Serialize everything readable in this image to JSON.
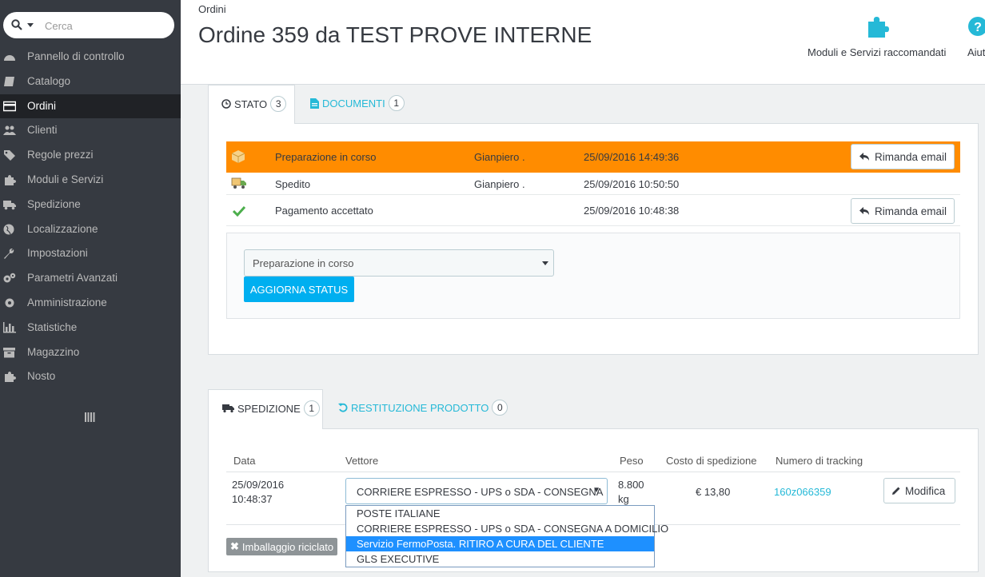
{
  "search": {
    "placeholder": "Cerca"
  },
  "sidebar": {
    "items": [
      {
        "label": "Pannello di controllo",
        "icon": "dashboard-icon"
      },
      {
        "label": "Catalogo",
        "icon": "book-icon"
      },
      {
        "label": "Ordini",
        "icon": "credit-card-icon",
        "active": true
      },
      {
        "label": "Clienti",
        "icon": "users-icon"
      },
      {
        "label": "Regole prezzi",
        "icon": "tags-icon"
      },
      {
        "label": "Moduli e Servizi",
        "icon": "puzzle-icon"
      },
      {
        "label": "Spedizione",
        "icon": "truck-icon"
      },
      {
        "label": "Localizzazione",
        "icon": "globe-icon"
      },
      {
        "label": "Impostazioni",
        "icon": "wrench-icon"
      },
      {
        "label": "Parametri Avanzati",
        "icon": "cogs-icon"
      },
      {
        "label": "Amministrazione",
        "icon": "cog-icon"
      },
      {
        "label": "Statistiche",
        "icon": "bar-chart-icon"
      },
      {
        "label": "Magazzino",
        "icon": "archive-icon"
      },
      {
        "label": "Nosto",
        "icon": "puzzle-icon"
      }
    ]
  },
  "header": {
    "breadcrumb": "Ordini",
    "title": "Ordine 359 da TEST PROVE INTERNE",
    "toolbar": {
      "modules_label": "Moduli e Servizi raccomandati",
      "help_label": "Aiut"
    }
  },
  "status_panel": {
    "tabs": [
      {
        "label": "STATO",
        "count": "3"
      },
      {
        "label": "DOCUMENTI",
        "count": "1"
      }
    ],
    "history": [
      {
        "state": "Preparazione in corso",
        "employee": "Gianpiero .",
        "date": "25/09/2016 14:49:36",
        "resend": "Rimanda email"
      },
      {
        "state": "Spedito",
        "employee": "Gianpiero .",
        "date": "25/09/2016 10:50:50",
        "resend": ""
      },
      {
        "state": "Pagamento accettato",
        "employee": "",
        "date": "25/09/2016 10:48:38",
        "resend": "Rimanda email"
      }
    ],
    "select_value": "Preparazione in corso",
    "update_button": "AGGIORNA STATUS"
  },
  "shipping_panel": {
    "tabs": [
      {
        "label": "SPEDIZIONE",
        "count": "1"
      },
      {
        "label": "RESTITUZIONE PRODOTTO",
        "count": "0"
      }
    ],
    "columns": [
      "Data",
      "Vettore",
      "Peso",
      "Costo di spedizione",
      "Numero di tracking"
    ],
    "row": {
      "date_line1": "25/09/2016",
      "date_line2": "10:48:37",
      "carrier_selected": "CORRIERE ESPRESSO - UPS o SDA - CONSEGNA",
      "weight_line1": "8.800",
      "weight_line2": "kg",
      "cost": "€ 13,80",
      "tracking": "160z066359",
      "modify": "Modifica"
    },
    "carrier_options": [
      "POSTE ITALIANE",
      "CORRIERE ESPRESSO - UPS o SDA - CONSEGNA A DOMICILIO",
      "Servizio FermoPosta. RITIRO A CURA DEL CLIENTE",
      "GLS EXECUTIVE"
    ],
    "highlighted_option_index": 2,
    "recycled_label": "Imballaggio riciclato"
  },
  "colors": {
    "sidebar_bg": "#363a41",
    "current_state": "#ff8c00",
    "accent": "#00aff0",
    "link": "#25b9d7"
  }
}
